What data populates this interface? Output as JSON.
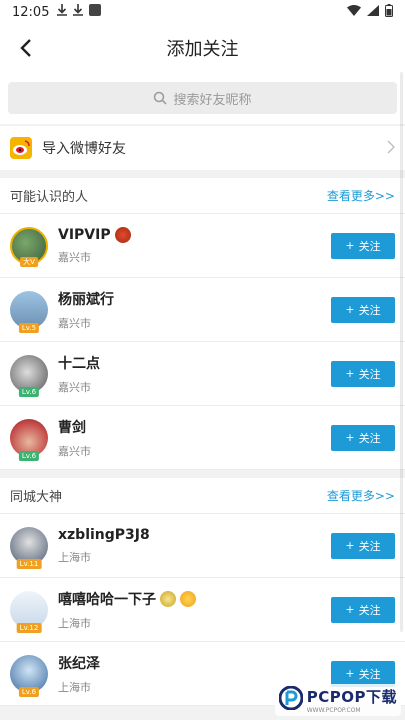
{
  "status": {
    "time": "12:05"
  },
  "header": {
    "title": "添加关注"
  },
  "search": {
    "placeholder": "搜索好友昵称"
  },
  "import": {
    "label": "导入微博好友"
  },
  "sections": [
    {
      "title": "可能认识的人",
      "more": "查看更多>>"
    },
    {
      "title": "同城大神",
      "more": "查看更多>>"
    }
  ],
  "follow_label": "关注",
  "users_known": [
    {
      "name": "VIPVIP",
      "city": "嘉兴市",
      "level": "大V"
    },
    {
      "name": "杨丽斌行",
      "city": "嘉兴市",
      "level": "Lv.5"
    },
    {
      "name": "十二点",
      "city": "嘉兴市",
      "level": "Lv.6"
    },
    {
      "name": "曹剑",
      "city": "嘉兴市",
      "level": "Lv.6"
    }
  ],
  "users_local": [
    {
      "name": "xzblingP3J8",
      "city": "上海市",
      "level": "Lv.11"
    },
    {
      "name": "嘻嘻哈哈一下子",
      "city": "上海市",
      "level": "Lv.12"
    },
    {
      "name": "张纪泽",
      "city": "上海市",
      "level": "Lv.6"
    }
  ],
  "watermark": {
    "brand": "PCPOP下载",
    "sub": "WWW.PCPOP.COM"
  },
  "colors": {
    "accent": "#1e9bd7",
    "level_orange": "#f0a020",
    "level_green": "#3cb371"
  }
}
